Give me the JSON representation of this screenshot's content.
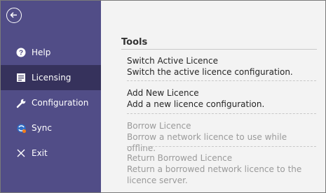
{
  "sidebar": {
    "back_label": "Back",
    "items": [
      {
        "label": "Help",
        "icon": "help-icon"
      },
      {
        "label": "Licensing",
        "icon": "licensing-icon",
        "active": true
      },
      {
        "label": "Configuration",
        "icon": "wrench-icon"
      },
      {
        "label": "Sync",
        "icon": "sync-icon"
      },
      {
        "label": "Exit",
        "icon": "close-icon"
      }
    ]
  },
  "main": {
    "section_title": "Tools",
    "actions": [
      {
        "title": "Switch Active Licence",
        "description": "Switch the active licence configuration.",
        "enabled": true
      },
      {
        "title": "Add New Licence",
        "description": "Add a new licence configuration.",
        "enabled": true
      },
      {
        "title": "Borrow Licence",
        "description": "Borrow a network licence to use while offline.",
        "enabled": false
      },
      {
        "title": "Return Borrowed Licence",
        "description": "Return a borrowed network licence to the licence server.",
        "enabled": false
      }
    ]
  },
  "colors": {
    "sidebar_bg": "#514d87",
    "sidebar_active_bg": "#36325c",
    "content_bg": "#f3f3f3",
    "disabled_text": "#9a9a9a"
  }
}
